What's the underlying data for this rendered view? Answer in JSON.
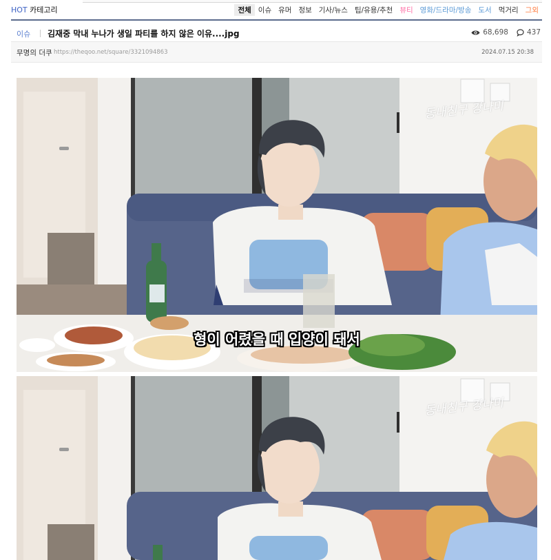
{
  "hot_category": {
    "tag": "HOT",
    "label": "카테고리"
  },
  "category_nav": [
    {
      "label": "전체",
      "color": "default"
    },
    {
      "label": "이슈",
      "color": "default"
    },
    {
      "label": "유머",
      "color": "default"
    },
    {
      "label": "정보",
      "color": "default"
    },
    {
      "label": "기사/뉴스",
      "color": "default"
    },
    {
      "label": "팁/유용/추천",
      "color": "default"
    },
    {
      "label": "뷰티",
      "color": "pink"
    },
    {
      "label": "영화/드라마/방송",
      "color": "blue"
    },
    {
      "label": "도서",
      "color": "blue"
    },
    {
      "label": "먹거리",
      "color": "default"
    },
    {
      "label": "그외",
      "color": "orange"
    }
  ],
  "post": {
    "category": "이슈",
    "title": "김재중 막내 누나가 생일 파티를 하지 않은 이유....jpg",
    "views": "68,698",
    "comments": "437",
    "author": "무명의 더쿠",
    "url": "https://theqoo.net/square/3321094863",
    "date": "2024.07.15 20:38"
  },
  "images": [
    {
      "subtitle": "형이 어렸을 때 입양이 돼서",
      "watermark": "동내친구 강나미"
    },
    {
      "subtitle": "",
      "watermark": "동내친구 강나미"
    }
  ],
  "colors": {
    "accent_blue": "#5b7fd0",
    "pink": "#ff6fa6",
    "light_blue": "#5b9ad6",
    "orange": "#ff7a3d",
    "nav_underline": "#5a6b8c"
  }
}
